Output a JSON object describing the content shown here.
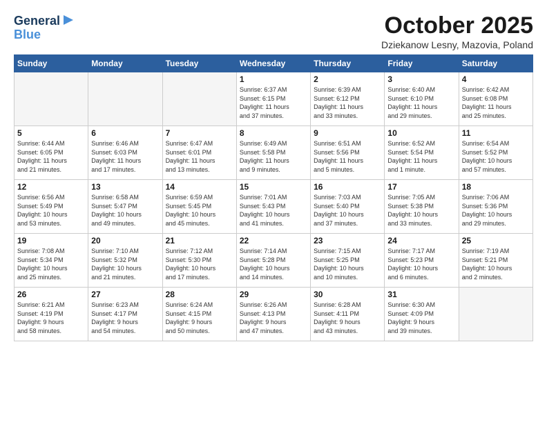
{
  "header": {
    "logo_line1": "General",
    "logo_line2": "Blue",
    "month": "October 2025",
    "location": "Dziekanow Lesny, Mazovia, Poland"
  },
  "weekdays": [
    "Sunday",
    "Monday",
    "Tuesday",
    "Wednesday",
    "Thursday",
    "Friday",
    "Saturday"
  ],
  "weeks": [
    [
      {
        "day": "",
        "info": ""
      },
      {
        "day": "",
        "info": ""
      },
      {
        "day": "",
        "info": ""
      },
      {
        "day": "1",
        "info": "Sunrise: 6:37 AM\nSunset: 6:15 PM\nDaylight: 11 hours\nand 37 minutes."
      },
      {
        "day": "2",
        "info": "Sunrise: 6:39 AM\nSunset: 6:12 PM\nDaylight: 11 hours\nand 33 minutes."
      },
      {
        "day": "3",
        "info": "Sunrise: 6:40 AM\nSunset: 6:10 PM\nDaylight: 11 hours\nand 29 minutes."
      },
      {
        "day": "4",
        "info": "Sunrise: 6:42 AM\nSunset: 6:08 PM\nDaylight: 11 hours\nand 25 minutes."
      }
    ],
    [
      {
        "day": "5",
        "info": "Sunrise: 6:44 AM\nSunset: 6:05 PM\nDaylight: 11 hours\nand 21 minutes."
      },
      {
        "day": "6",
        "info": "Sunrise: 6:46 AM\nSunset: 6:03 PM\nDaylight: 11 hours\nand 17 minutes."
      },
      {
        "day": "7",
        "info": "Sunrise: 6:47 AM\nSunset: 6:01 PM\nDaylight: 11 hours\nand 13 minutes."
      },
      {
        "day": "8",
        "info": "Sunrise: 6:49 AM\nSunset: 5:58 PM\nDaylight: 11 hours\nand 9 minutes."
      },
      {
        "day": "9",
        "info": "Sunrise: 6:51 AM\nSunset: 5:56 PM\nDaylight: 11 hours\nand 5 minutes."
      },
      {
        "day": "10",
        "info": "Sunrise: 6:52 AM\nSunset: 5:54 PM\nDaylight: 11 hours\nand 1 minute."
      },
      {
        "day": "11",
        "info": "Sunrise: 6:54 AM\nSunset: 5:52 PM\nDaylight: 10 hours\nand 57 minutes."
      }
    ],
    [
      {
        "day": "12",
        "info": "Sunrise: 6:56 AM\nSunset: 5:49 PM\nDaylight: 10 hours\nand 53 minutes."
      },
      {
        "day": "13",
        "info": "Sunrise: 6:58 AM\nSunset: 5:47 PM\nDaylight: 10 hours\nand 49 minutes."
      },
      {
        "day": "14",
        "info": "Sunrise: 6:59 AM\nSunset: 5:45 PM\nDaylight: 10 hours\nand 45 minutes."
      },
      {
        "day": "15",
        "info": "Sunrise: 7:01 AM\nSunset: 5:43 PM\nDaylight: 10 hours\nand 41 minutes."
      },
      {
        "day": "16",
        "info": "Sunrise: 7:03 AM\nSunset: 5:40 PM\nDaylight: 10 hours\nand 37 minutes."
      },
      {
        "day": "17",
        "info": "Sunrise: 7:05 AM\nSunset: 5:38 PM\nDaylight: 10 hours\nand 33 minutes."
      },
      {
        "day": "18",
        "info": "Sunrise: 7:06 AM\nSunset: 5:36 PM\nDaylight: 10 hours\nand 29 minutes."
      }
    ],
    [
      {
        "day": "19",
        "info": "Sunrise: 7:08 AM\nSunset: 5:34 PM\nDaylight: 10 hours\nand 25 minutes."
      },
      {
        "day": "20",
        "info": "Sunrise: 7:10 AM\nSunset: 5:32 PM\nDaylight: 10 hours\nand 21 minutes."
      },
      {
        "day": "21",
        "info": "Sunrise: 7:12 AM\nSunset: 5:30 PM\nDaylight: 10 hours\nand 17 minutes."
      },
      {
        "day": "22",
        "info": "Sunrise: 7:14 AM\nSunset: 5:28 PM\nDaylight: 10 hours\nand 14 minutes."
      },
      {
        "day": "23",
        "info": "Sunrise: 7:15 AM\nSunset: 5:25 PM\nDaylight: 10 hours\nand 10 minutes."
      },
      {
        "day": "24",
        "info": "Sunrise: 7:17 AM\nSunset: 5:23 PM\nDaylight: 10 hours\nand 6 minutes."
      },
      {
        "day": "25",
        "info": "Sunrise: 7:19 AM\nSunset: 5:21 PM\nDaylight: 10 hours\nand 2 minutes."
      }
    ],
    [
      {
        "day": "26",
        "info": "Sunrise: 6:21 AM\nSunset: 4:19 PM\nDaylight: 9 hours\nand 58 minutes."
      },
      {
        "day": "27",
        "info": "Sunrise: 6:23 AM\nSunset: 4:17 PM\nDaylight: 9 hours\nand 54 minutes."
      },
      {
        "day": "28",
        "info": "Sunrise: 6:24 AM\nSunset: 4:15 PM\nDaylight: 9 hours\nand 50 minutes."
      },
      {
        "day": "29",
        "info": "Sunrise: 6:26 AM\nSunset: 4:13 PM\nDaylight: 9 hours\nand 47 minutes."
      },
      {
        "day": "30",
        "info": "Sunrise: 6:28 AM\nSunset: 4:11 PM\nDaylight: 9 hours\nand 43 minutes."
      },
      {
        "day": "31",
        "info": "Sunrise: 6:30 AM\nSunset: 4:09 PM\nDaylight: 9 hours\nand 39 minutes."
      },
      {
        "day": "",
        "info": ""
      }
    ]
  ]
}
